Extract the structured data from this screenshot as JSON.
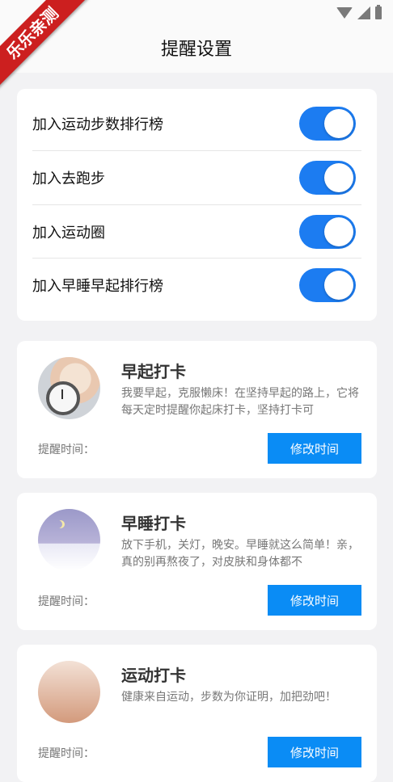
{
  "watermark": "乐乐亲测",
  "header": {
    "title": "提醒设置"
  },
  "toggles": [
    {
      "label": "加入运动步数排行榜",
      "on": true
    },
    {
      "label": "加入去跑步",
      "on": true
    },
    {
      "label": "加入运动圈",
      "on": true
    },
    {
      "label": "加入早睡早起排行榜",
      "on": true
    }
  ],
  "reminders": [
    {
      "title": "早起打卡",
      "desc": "我要早起，克服懒床！在坚持早起的路上，它将每天定时提醒你起床打卡，坚持打卡可",
      "time_label": "提醒时间：",
      "button": "修改时间",
      "image": "alarm-clock-wakeup"
    },
    {
      "title": "早睡打卡",
      "desc": "放下手机，关灯，晚安。早睡就这么简单！亲，真的别再熬夜了，对皮肤和身体都不",
      "time_label": "提醒时间：",
      "button": "修改时间",
      "image": "night-moon"
    },
    {
      "title": "运动打卡",
      "desc": "健康来自运动，步数为你证明，加把劲吧！",
      "time_label": "提醒时间：",
      "button": "修改时间",
      "image": "running-legs"
    }
  ],
  "colors": {
    "toggle_on": "#1c7cf1",
    "button": "#0a8cf5",
    "ribbon": "#cc1f1f"
  }
}
